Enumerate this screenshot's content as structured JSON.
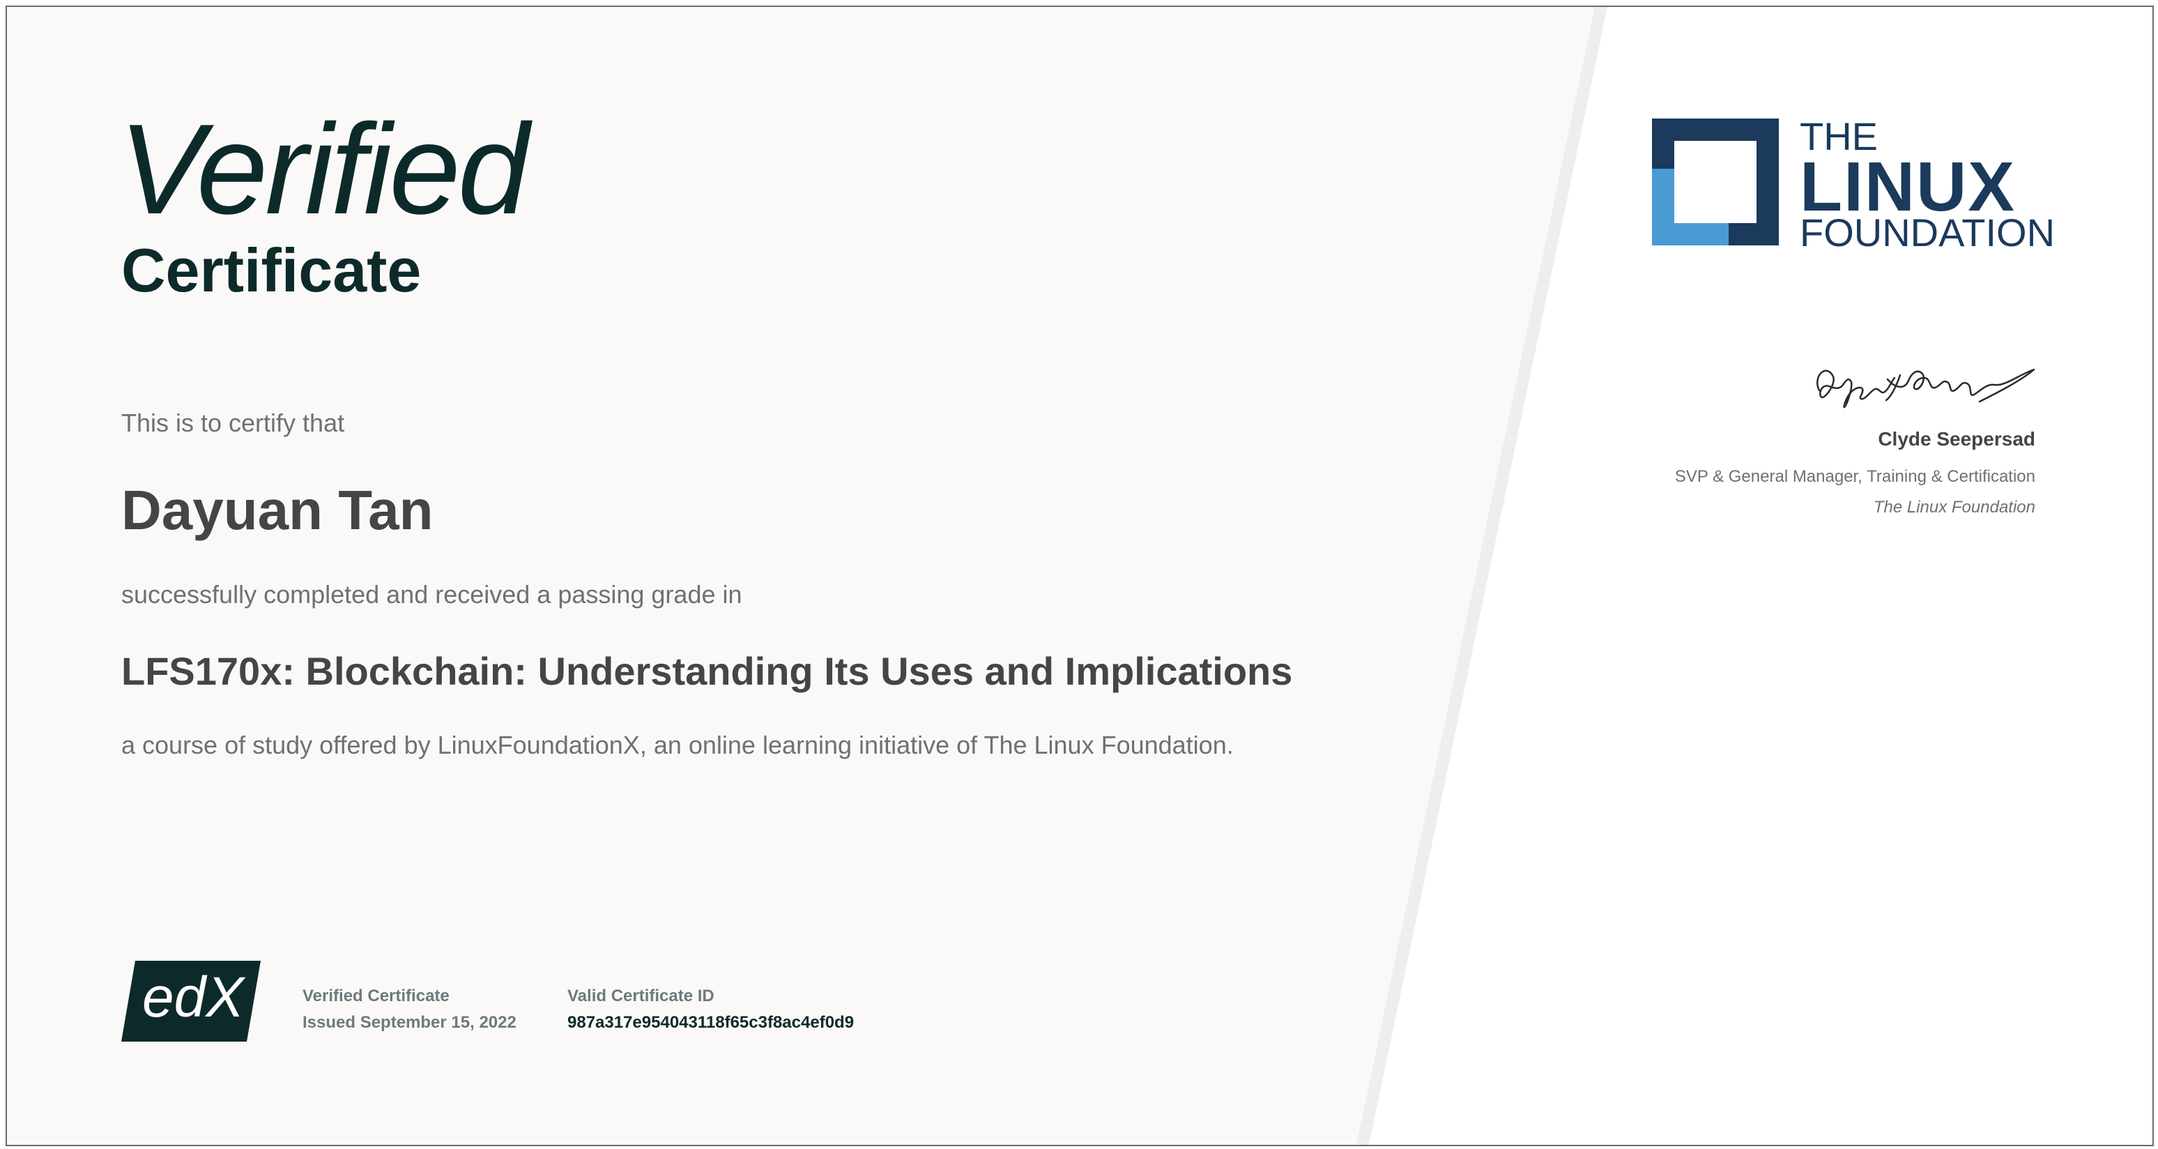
{
  "certificate": {
    "verified_word": "Verified",
    "certificate_word": "Certificate",
    "certify_text": "This is to certify that",
    "recipient_name": "Dayuan Tan",
    "completed_text": "successfully completed and received a passing grade in",
    "course_title": "LFS170x: Blockchain: Understanding Its Uses and Implications",
    "course_description": "a course of study offered by LinuxFoundationX, an online learning initiative of The Linux Foundation."
  },
  "footer": {
    "edx_logo_text": "edX",
    "cert_type_label": "Verified Certificate",
    "issued_text": "Issued September 15, 2022",
    "cert_id_label": "Valid Certificate ID",
    "cert_id": "987a317e954043118f65c3f8ac4ef0d9"
  },
  "organization": {
    "logo_line1": "THE",
    "logo_line2": "LINUX",
    "logo_line3": "FOUNDATION",
    "logo_dark_color": "#1b3a5c",
    "logo_light_color": "#4a9bd4"
  },
  "signatory": {
    "name": "Clyde Seepersad",
    "title": "SVP & General Manager, Training & Certification",
    "organization": "The Linux Foundation"
  },
  "colors": {
    "heading": "#0d2a2b",
    "left_panel_bg": "#faf9f7",
    "divider": "#eeeeed"
  }
}
